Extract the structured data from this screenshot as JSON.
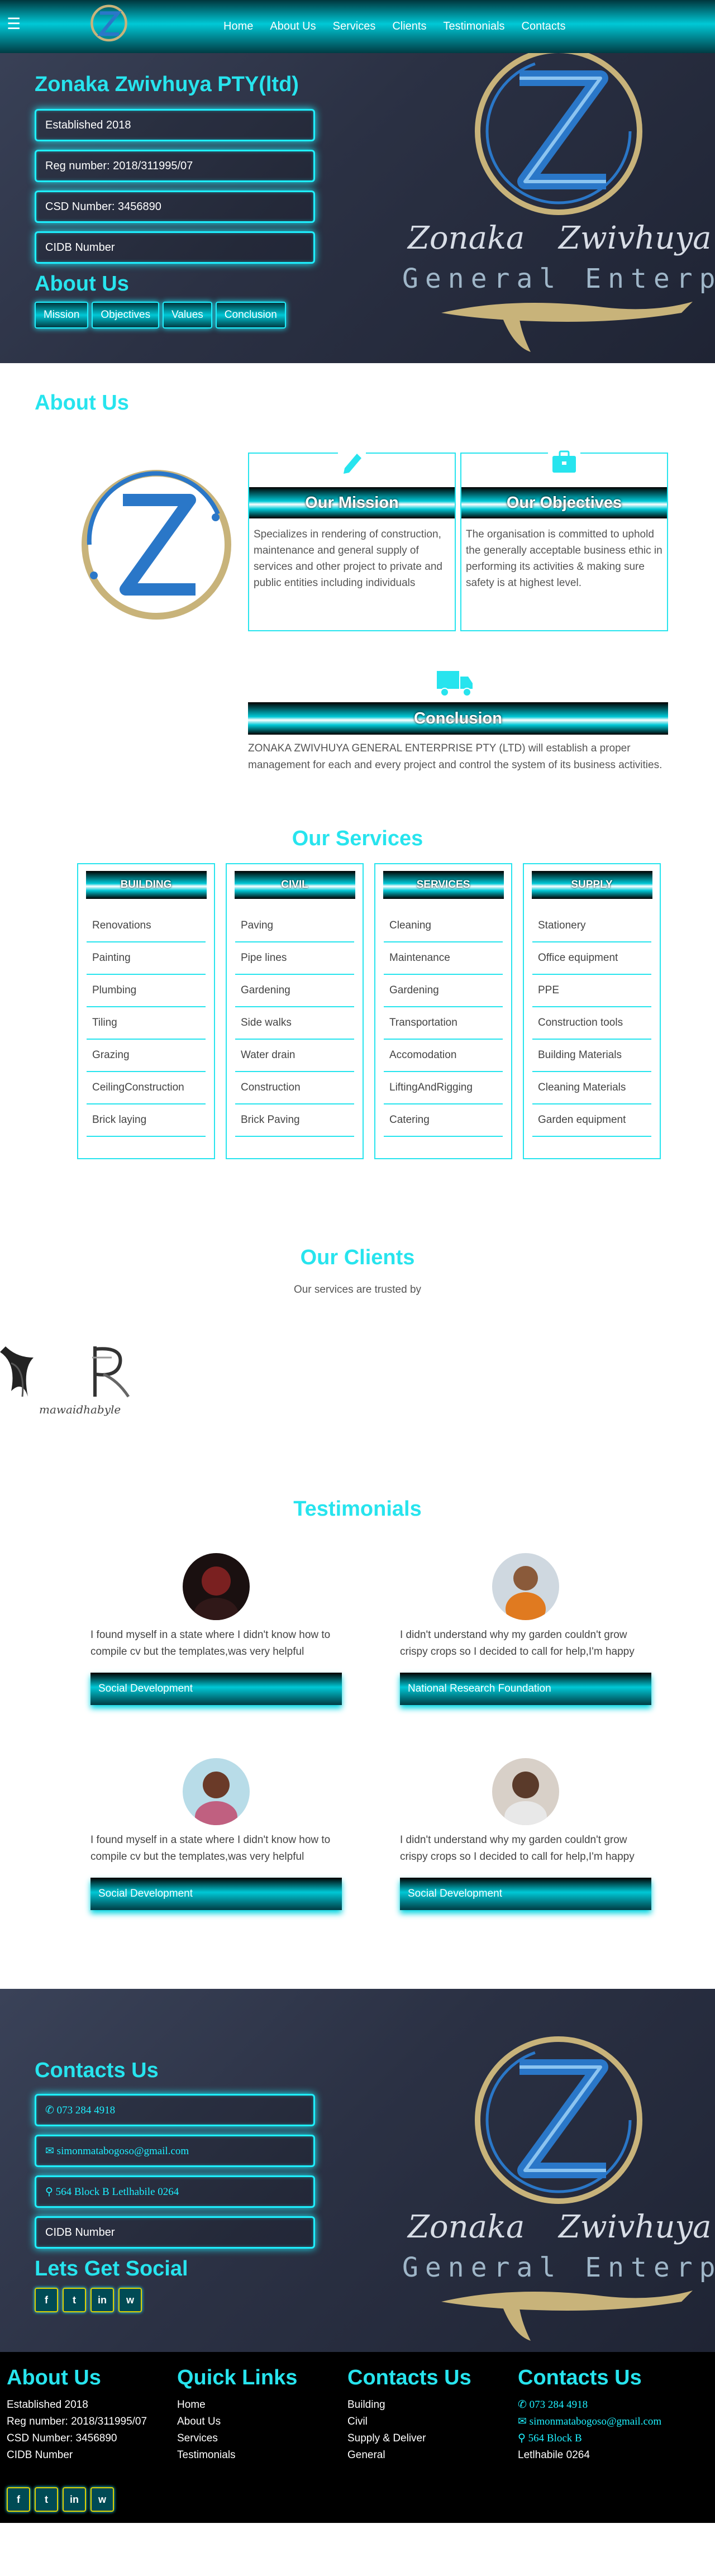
{
  "nav": {
    "links": [
      "Home",
      "About Us",
      "Services",
      "Clients",
      "Testimonials",
      "Contacts"
    ]
  },
  "hero": {
    "company": "Zonaka Zwivhuya PTY(ltd)",
    "info": [
      "Established 2018",
      "Reg number: 2018/311995/07",
      "CSD Number: 3456890",
      "CIDB Number"
    ],
    "about_title": "About  Us",
    "pills": [
      "Mission",
      "Objectives",
      "Values",
      "Conclusion"
    ],
    "logo_word1": "Zonaka",
    "logo_word2": "Zwivhuya",
    "logo_line2": "General Enterpri"
  },
  "about": {
    "title": "About Us",
    "mission_title": "Our Mission",
    "mission_text": "Specializes in rendering of construction, maintenance and general supply of services and other project to private and public entities including individuals",
    "objectives_title": "Our Objectives",
    "objectives_text": "The organisation is committed to uphold the generally acceptable business ethic in performing its activities & making sure safety is at highest level.",
    "conclusion_title": "Conclusion",
    "conclusion_text": "ZONAKA ZWIVHUYA GENERAL ENTERPRISE PTY (LTD) will establish a proper management for each and every project and control the system of its business activities."
  },
  "services": {
    "title": "Our Services",
    "columns": [
      {
        "title": "BUILDING",
        "items": [
          "Renovations",
          "Painting",
          "Plumbing",
          "Tiling",
          "Grazing",
          "CeilingConstruction",
          "Brick laying"
        ]
      },
      {
        "title": "CIVIL",
        "items": [
          "Paving",
          "Pipe lines",
          "Gardening",
          "Side walks",
          "Water drain",
          "Construction",
          "Brick Paving"
        ]
      },
      {
        "title": "SERVICES",
        "items": [
          "Cleaning",
          "Maintenance",
          "Gardening",
          "Transportation",
          "Accomodation",
          "LiftingAndRigging",
          "Catering"
        ]
      },
      {
        "title": "SUPPLY",
        "items": [
          "Stationery",
          "Office equipment",
          "PPE",
          "Construction tools",
          "Building Materials",
          "Cleaning Materials",
          "Garden equipment"
        ]
      }
    ]
  },
  "clients": {
    "title": "Our Clients",
    "subtitle": "Our services are trusted by",
    "logo_text": "mawaidhabyle"
  },
  "testimonials": {
    "title": "Testimonials",
    "items": [
      {
        "quote": "I found myself in a state where I didn't know how to compile cv but the templates,was very helpful",
        "source": "Social Development"
      },
      {
        "quote": "I didn't understand why my garden couldn't grow crispy crops so I decided to call for help,I'm happy",
        "source": "National Research Foundation"
      },
      {
        "quote": "I found myself in a state where I didn't know how to compile cv but the templates,was very helpful",
        "source": "Social Development"
      },
      {
        "quote": "I didn't understand why my garden couldn't grow crispy crops so I decided to call for help,I'm happy",
        "source": "Social Development"
      }
    ]
  },
  "contact": {
    "title": "Contacts Us",
    "phone": "073 284 4918",
    "email": "simonmatabogoso@gmail.com",
    "address": "564 Block B Letlhabile 0264",
    "cidb": "CIDB Number",
    "social_title": "Lets Get Social",
    "socials": [
      "f",
      "t",
      "in",
      "w"
    ]
  },
  "footer": {
    "about_title": "About Us",
    "about_lines": [
      "Established 2018",
      "Reg number: 2018/311995/07",
      "CSD Number: 3456890",
      "CIDB Number"
    ],
    "links_title": "Quick Links",
    "links": [
      "Home",
      "About Us",
      "Services",
      "Testimonials"
    ],
    "contacts1_title": "Contacts Us",
    "contacts1_lines": [
      "Building",
      "Civil",
      "Supply & Deliver",
      "General"
    ],
    "contacts2_title": "Contacts Us",
    "phone": "073 284 4918",
    "email": "simonmatabogoso@gmail.com",
    "address": "564 Block B",
    "city": "Letlhabile 0264"
  },
  "colors": {
    "accent": "#27e4ee",
    "glow": "#1ef0ff",
    "logo_blue": "#2a77c8",
    "logo_gold": "#c8b37a"
  }
}
